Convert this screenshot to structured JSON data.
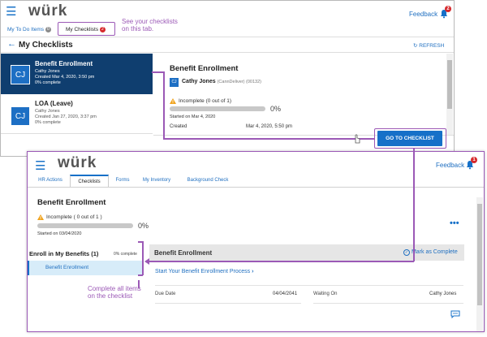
{
  "top_window": {
    "logo": "würk",
    "feedback": "Feedback",
    "notification_count": "2",
    "tabs": [
      {
        "label": "My To Do Items",
        "count": "0"
      },
      {
        "label": "My Checklists",
        "count": "2"
      }
    ],
    "section_title": "My Checklists",
    "refresh_label": "REFRESH",
    "checklists": [
      {
        "initials": "CJ",
        "title": "Benefit Enrollment",
        "person": "Cathy Jones",
        "created": "Created Mar 4, 2020, 3:50 pm",
        "status": "0% complete"
      },
      {
        "initials": "CJ",
        "title": "LOA (Leave)",
        "person": "Cathy Jones",
        "created": "Created Jan 27, 2020, 3:37 pm",
        "status": "0% complete"
      }
    ],
    "detail": {
      "title": "Benefit Enrollment",
      "avatar_initials": "CJ",
      "person": "Cathy Jones",
      "person_sub": "(CannDeliver) (00132)",
      "status": "Incomplete (0 out of 1)",
      "percent_label": "0%",
      "progress": 0,
      "started": "Started on Mar 4, 2020",
      "created_label": "Created",
      "created_value": "Mar 4, 2020, 5:50 pm"
    },
    "go_button": "GO TO CHECKLIST"
  },
  "annotations": {
    "tab_note_line1": "See your checklists",
    "tab_note_line2": "on this tab.",
    "items_note_line1": "Complete all items",
    "items_note_line2": "on the checklist"
  },
  "front_window": {
    "logo": "würk",
    "feedback": "Feedback",
    "notification_count": "1",
    "tabs": [
      "HR Actions",
      "Checklists",
      "Forms",
      "My Inventory",
      "Background Check"
    ],
    "title": "Benefit Enrollment",
    "status": "Incomplete ( 0 out of 1 )",
    "percent_label": "0%",
    "progress": 0,
    "started": "Started on 03/04/2020",
    "menu": "•••",
    "group_title": "Enroll in My Benefits (1)",
    "group_status": "0% complete",
    "group_item": "Benefit Enrollment",
    "item_title": "Benefit Enrollment",
    "mark_complete": "Mark as Complete",
    "start_link": "Start Your Benefit Enrollment Process",
    "due_label": "Due Date",
    "due_value": "04/04/2041",
    "waiting_label": "Waiting On",
    "waiting_value": "Cathy Jones"
  },
  "colors": {
    "accent": "#1670c8",
    "selected_card": "#0f3e6f",
    "annotation": "#9b59b6",
    "badge": "#d6282b"
  }
}
